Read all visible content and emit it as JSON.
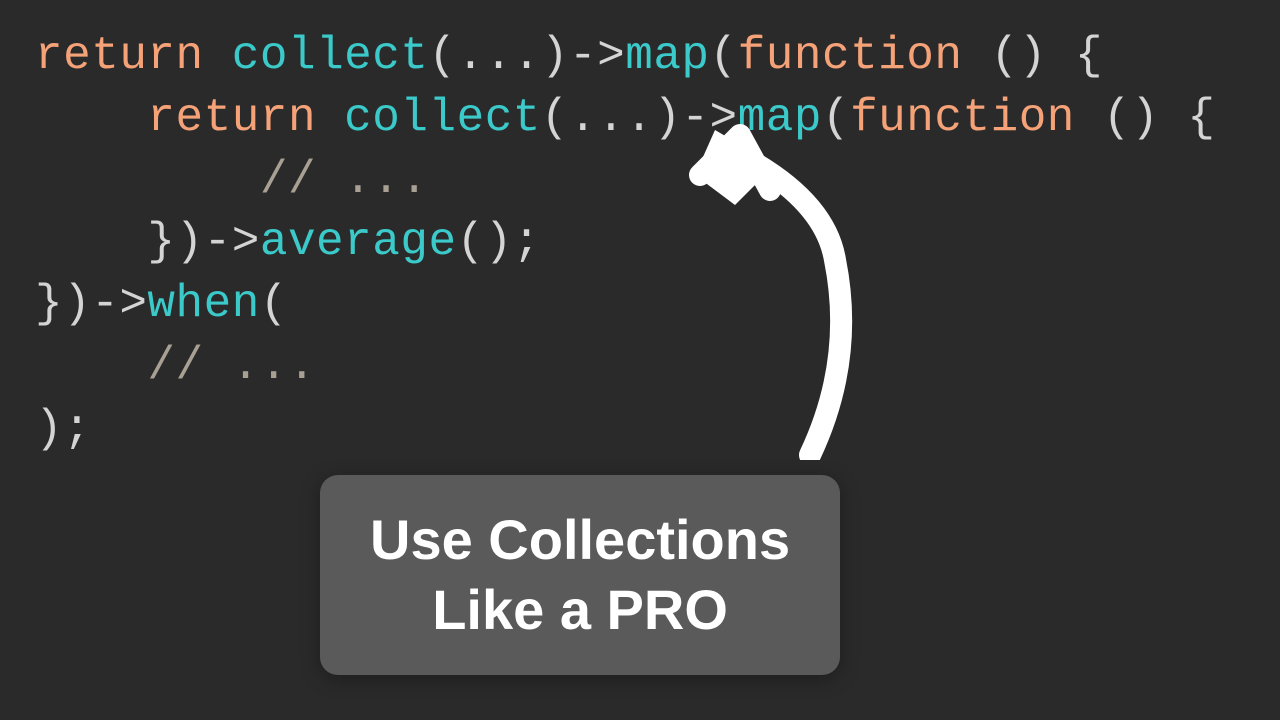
{
  "code": {
    "lines": [
      {
        "indent": 0,
        "tokens": [
          {
            "class": "tk-keyword",
            "text": "return"
          },
          {
            "class": "tk-punct",
            "text": " "
          },
          {
            "class": "tk-method",
            "text": "collect"
          },
          {
            "class": "tk-punct",
            "text": "(...)->"
          },
          {
            "class": "tk-method",
            "text": "map"
          },
          {
            "class": "tk-punct",
            "text": "("
          },
          {
            "class": "tk-keyword",
            "text": "function"
          },
          {
            "class": "tk-punct",
            "text": " () {"
          }
        ]
      },
      {
        "indent": 1,
        "tokens": [
          {
            "class": "tk-keyword",
            "text": "return"
          },
          {
            "class": "tk-punct",
            "text": " "
          },
          {
            "class": "tk-method",
            "text": "collect"
          },
          {
            "class": "tk-punct",
            "text": "(...)->"
          },
          {
            "class": "tk-method",
            "text": "map"
          },
          {
            "class": "tk-punct",
            "text": "("
          },
          {
            "class": "tk-keyword",
            "text": "function"
          },
          {
            "class": "tk-punct",
            "text": " () {"
          }
        ]
      },
      {
        "indent": 2,
        "tokens": [
          {
            "class": "tk-comment",
            "text": "// ..."
          }
        ]
      },
      {
        "indent": 1,
        "tokens": [
          {
            "class": "tk-punct",
            "text": "})->"
          },
          {
            "class": "tk-method",
            "text": "average"
          },
          {
            "class": "tk-punct",
            "text": "();"
          }
        ]
      },
      {
        "indent": 0,
        "tokens": [
          {
            "class": "tk-punct",
            "text": "})->"
          },
          {
            "class": "tk-method",
            "text": "when"
          },
          {
            "class": "tk-punct",
            "text": "("
          }
        ]
      },
      {
        "indent": 1,
        "tokens": [
          {
            "class": "tk-comment",
            "text": "// ..."
          }
        ]
      },
      {
        "indent": 0,
        "tokens": [
          {
            "class": "tk-punct",
            "text": ");"
          }
        ]
      }
    ],
    "indent_unit": "    "
  },
  "callout": {
    "text": "Use Collections\nLike a PRO"
  }
}
